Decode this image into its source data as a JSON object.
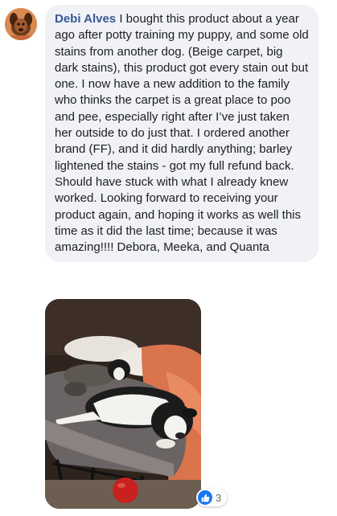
{
  "comment": {
    "author": "Debi Alves",
    "text": "I bought this product about a year ago after potty training my puppy, and some old stains from another dog. (Beige carpet, big dark stains), this product got every stain out but one. I now have a new addition to the family who thinks the carpet is a great place to poo and pee, especially right after I’ve just taken her outside to do just that. I ordered another brand (FF), and it did hardly anything; barley lightened the stains - got my full refund back. Should have stuck with what I already knew worked. Looking forward to receiving your product again, and hoping it works as well this time as it did the last time; because it was amazing!!!! Debora, Meeka, and Quanta"
  },
  "reactions": {
    "icon": "thumbs-up-icon",
    "count": "3",
    "color": "#1877f2"
  },
  "colors": {
    "author_link": "#385898",
    "bubble_bg": "#f0f2f5",
    "text": "#1c1e21"
  }
}
